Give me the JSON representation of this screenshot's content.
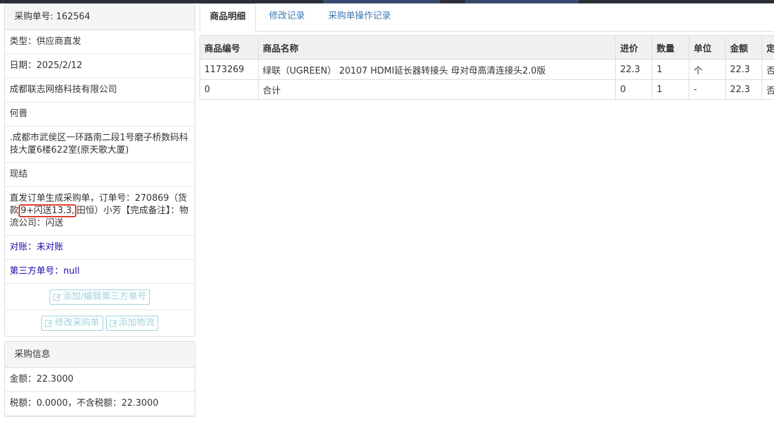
{
  "left": {
    "order_header": "采购单号: 162564",
    "type": "类型：供应商直发",
    "date": "日期：2025/2/12",
    "company": "成都联志网络科技有限公司",
    "contact": "何晋",
    "address": ".成都市武侯区一环路南二段1号磨子桥数码科技大厦6楼622室(原天歌大厦)",
    "settle": "现结",
    "note_pre": "直发订单生成采购单，订单号：270869（货款",
    "note_highlight": "9+闪送13.3,",
    "note_post": "田恒）小芳【完成备注】：物流公司：闪送",
    "reconcile": "对账：未对账",
    "third_party": "第三方单号：null",
    "btn_add_third": "添加/编辑第三方单号",
    "btn_edit_po": "修改采购单",
    "btn_add_logistics": "添加物流",
    "info_header": "采购信息",
    "amount": "金额：22.3000",
    "tax": "税额：0.0000，不含税额：22.3000"
  },
  "tabs": [
    "商品明细",
    "修改记录",
    "采购单操作记录"
  ],
  "table": {
    "columns": [
      "商品编号",
      "商品名称",
      "进价",
      "数量",
      "单位",
      "金额",
      "定"
    ],
    "rows": [
      [
        "1173269",
        "绿联（UGREEN） 20107 HDMI延长器转接头 母对母高清连接头2.0版",
        "22.3",
        "1",
        "个",
        "22.3",
        "否"
      ],
      [
        "0",
        "合计",
        "0",
        "1",
        "-",
        "22.3",
        "否"
      ]
    ]
  }
}
